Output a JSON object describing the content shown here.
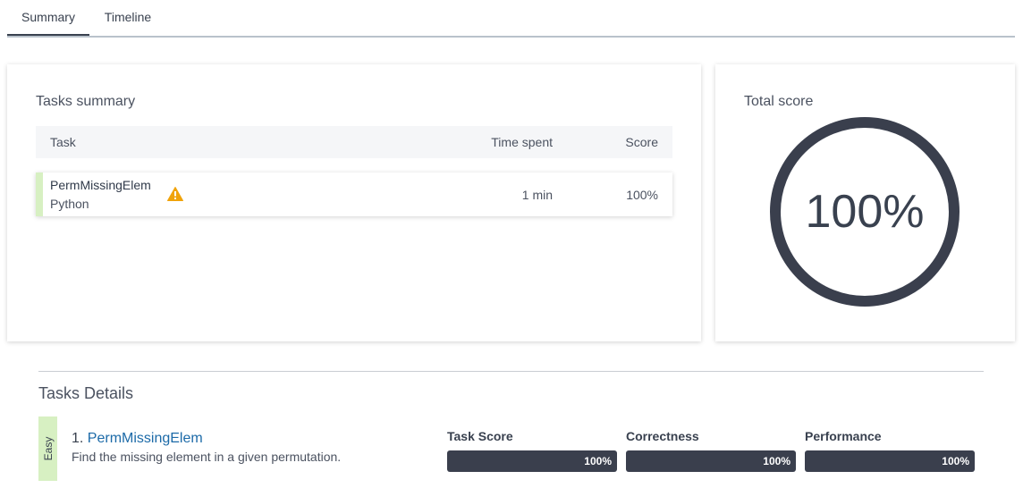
{
  "tabs": [
    {
      "label": "Summary",
      "active": true
    },
    {
      "label": "Timeline",
      "active": false
    }
  ],
  "tasks_summary": {
    "title": "Tasks summary",
    "columns": {
      "task": "Task",
      "time_spent": "Time spent",
      "score": "Score"
    },
    "rows": [
      {
        "name": "PermMissingElem",
        "language": "Python",
        "warning_icon": "warning-icon",
        "time_spent": "1 min",
        "score": "100%"
      }
    ]
  },
  "total_score": {
    "title": "Total score",
    "value": "100%",
    "fraction": 1.0
  },
  "tasks_details": {
    "title": "Tasks Details",
    "tasks": [
      {
        "difficulty": "Easy",
        "number": "1.",
        "name": "PermMissingElem",
        "description": "Find the missing element in a given permutation.",
        "metrics": [
          {
            "label": "Task Score",
            "value": "100%",
            "fraction": 1.0
          },
          {
            "label": "Correctness",
            "value": "100%",
            "fraction": 1.0
          },
          {
            "label": "Performance",
            "value": "100%",
            "fraction": 1.0
          }
        ]
      }
    ]
  },
  "colors": {
    "accent_dark": "#3a3f4d",
    "easy_green": "#d7f0c2",
    "link_blue": "#1c6aa8",
    "warning_orange": "#f0a30a"
  }
}
